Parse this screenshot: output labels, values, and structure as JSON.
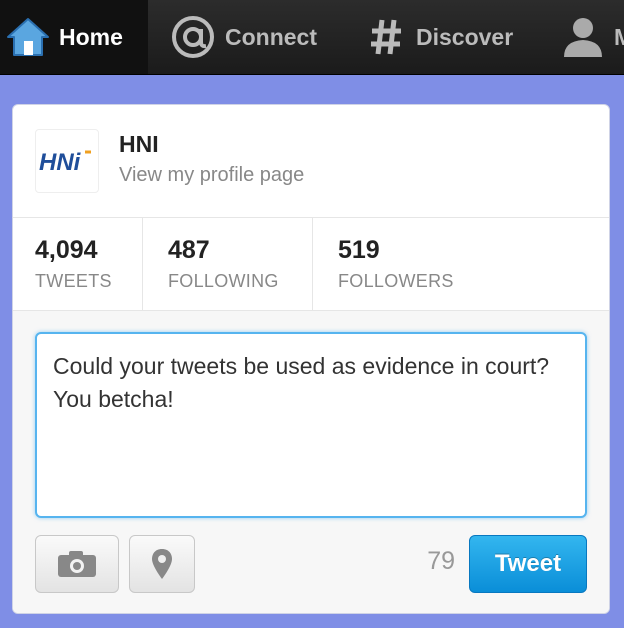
{
  "nav": {
    "home_label": "Home",
    "connect_label": "Connect",
    "discover_label": "Discover",
    "me_label": "Me",
    "home_icon": "house-icon",
    "connect_icon": "at-sign-icon",
    "discover_icon": "hashtag-icon",
    "me_icon": "person-icon"
  },
  "profile": {
    "name": "HNI",
    "link_text": "View my profile page",
    "avatar_text": "HNi"
  },
  "stats": [
    {
      "value": "4,094",
      "label": "TWEETS"
    },
    {
      "value": "487",
      "label": "FOLLOWING"
    },
    {
      "value": "519",
      "label": "FOLLOWERS"
    }
  ],
  "composer": {
    "text": "Could your tweets be used as evidence in court?  You betcha!",
    "char_count": "79",
    "tweet_button": "Tweet",
    "photo_icon": "camera-icon",
    "location_icon": "location-pin-icon"
  },
  "colors": {
    "accent": "#56b4ef",
    "tweet_button": "#1ba1e8",
    "background": "#7f8ee6",
    "nav_bar": "#222222"
  }
}
